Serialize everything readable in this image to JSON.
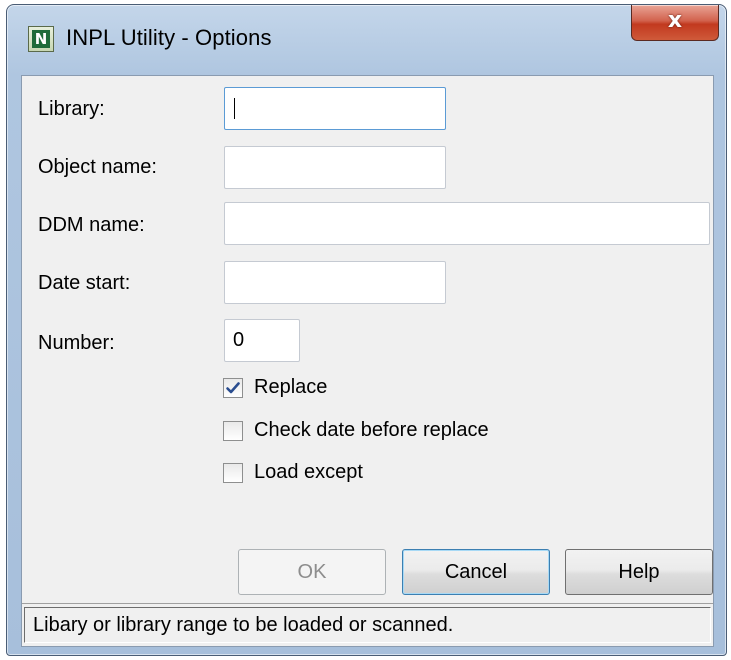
{
  "window": {
    "title": "INPL Utility - Options",
    "app_icon_letter": "N",
    "close_glyph": "x"
  },
  "form": {
    "library": {
      "label": "Library:",
      "value": ""
    },
    "object_name": {
      "label": "Object name:",
      "value": ""
    },
    "ddm_name": {
      "label": "DDM name:",
      "value": ""
    },
    "date_start": {
      "label": "Date start:",
      "value": ""
    },
    "number": {
      "label": "Number:",
      "value": "0"
    }
  },
  "checkboxes": [
    {
      "label": "Replace",
      "checked": true
    },
    {
      "label": "Check date before replace",
      "checked": false
    },
    {
      "label": "Load except",
      "checked": false
    }
  ],
  "buttons": {
    "ok": "OK",
    "cancel": "Cancel",
    "help": "Help"
  },
  "status": {
    "text": "Libary or library range to be loaded or scanned."
  },
  "colors": {
    "frame": "#afc6e0",
    "close_button": "#c2391f",
    "focus_border": "#5b9bd5",
    "dialog_bg": "#f0f0f0"
  }
}
